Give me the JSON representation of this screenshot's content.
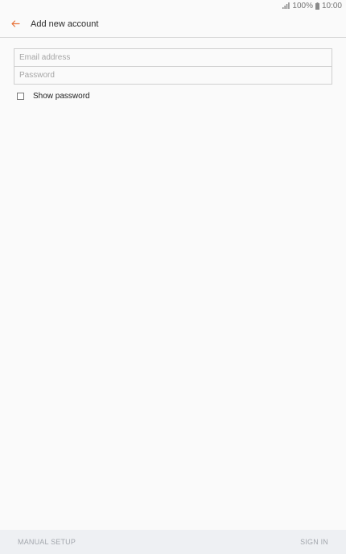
{
  "status_bar": {
    "battery": "100%",
    "time": "10:00",
    "icons": [
      "signal-icon",
      "battery-icon"
    ]
  },
  "header": {
    "title": "Add new account",
    "back_icon": "arrow-left-icon",
    "accent_color": "#e8733a"
  },
  "form": {
    "email": {
      "value": "",
      "placeholder": "Email address"
    },
    "password": {
      "value": "",
      "placeholder": "Password"
    },
    "show_password": {
      "label": "Show password",
      "checked": false
    }
  },
  "bottom_bar": {
    "manual_setup_label": "MANUAL SETUP",
    "sign_in_label": "SIGN IN"
  }
}
